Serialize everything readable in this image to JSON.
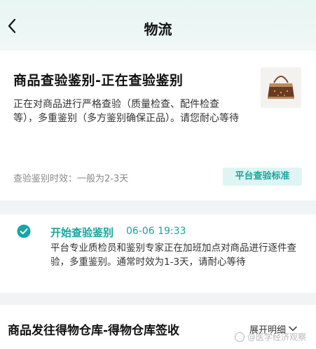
{
  "nav": {
    "title": "物流",
    "back_icon": "chevron-left-icon"
  },
  "status": {
    "title": "商品查验鉴别-正在查验鉴别",
    "description": "正在对商品进行严格查验（质量检查、配件检查等），多重鉴别（多方鉴别确保正品）。请您耐心等待",
    "time_note": "查验鉴别时效：一般为2-3天",
    "standard_badge": "平台查验标准",
    "product_image": "handbag-thumbnail"
  },
  "timeline": [
    {
      "title": "开始查验鉴别",
      "time": "06-06 19:33",
      "description": "平台专业质检员和鉴别专家正在加班加点对商品进行逐件查验，多重鉴别。通常时效为1-3天，请耐心等待",
      "icon": "check-circle-icon"
    }
  ],
  "section": {
    "title": "商品发往得物仓库-得物仓库签收",
    "expand_label": "展开明细",
    "expand_icon": "chevron-down-icon"
  },
  "watermark": {
    "text": "@医学经济观察"
  },
  "colors": {
    "accent": "#17a6a0",
    "badge_bg": "#dff5f3",
    "nav_bg": "#e7f6f4"
  }
}
